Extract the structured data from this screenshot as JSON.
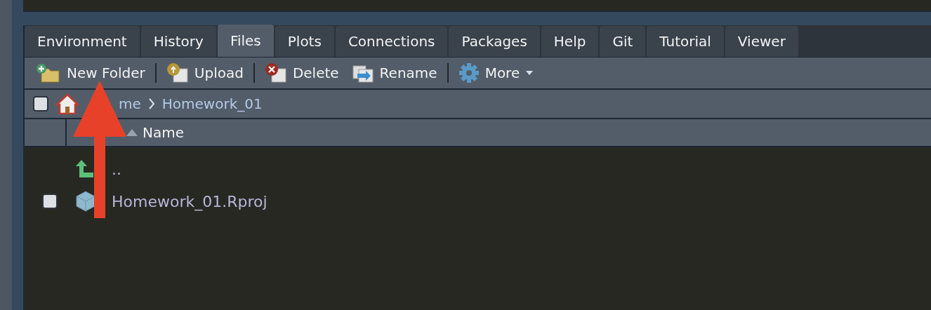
{
  "tabs": [
    {
      "label": "Environment",
      "selected": false
    },
    {
      "label": "History",
      "selected": false
    },
    {
      "label": "Files",
      "selected": true
    },
    {
      "label": "Plots",
      "selected": false
    },
    {
      "label": "Connections",
      "selected": false
    },
    {
      "label": "Packages",
      "selected": false
    },
    {
      "label": "Help",
      "selected": false
    },
    {
      "label": "Git",
      "selected": false
    },
    {
      "label": "Tutorial",
      "selected": false
    },
    {
      "label": "Viewer",
      "selected": false
    }
  ],
  "toolbar": [
    {
      "kind": "new-folder",
      "label": "New Folder"
    },
    {
      "kind": "upload",
      "label": "Upload"
    },
    {
      "kind": "delete",
      "label": "Delete"
    },
    {
      "kind": "rename",
      "label": "Rename"
    },
    {
      "kind": "more",
      "label": "More"
    }
  ],
  "breadcrumb": {
    "checked": false,
    "parts": [
      "me",
      "Homework_01"
    ]
  },
  "table": {
    "columns": [
      "Name"
    ]
  },
  "files": [
    {
      "kind": "parent",
      "name": ".."
    },
    {
      "kind": "rproj",
      "name": "Homework_01.Rproj",
      "checked": false
    }
  ]
}
